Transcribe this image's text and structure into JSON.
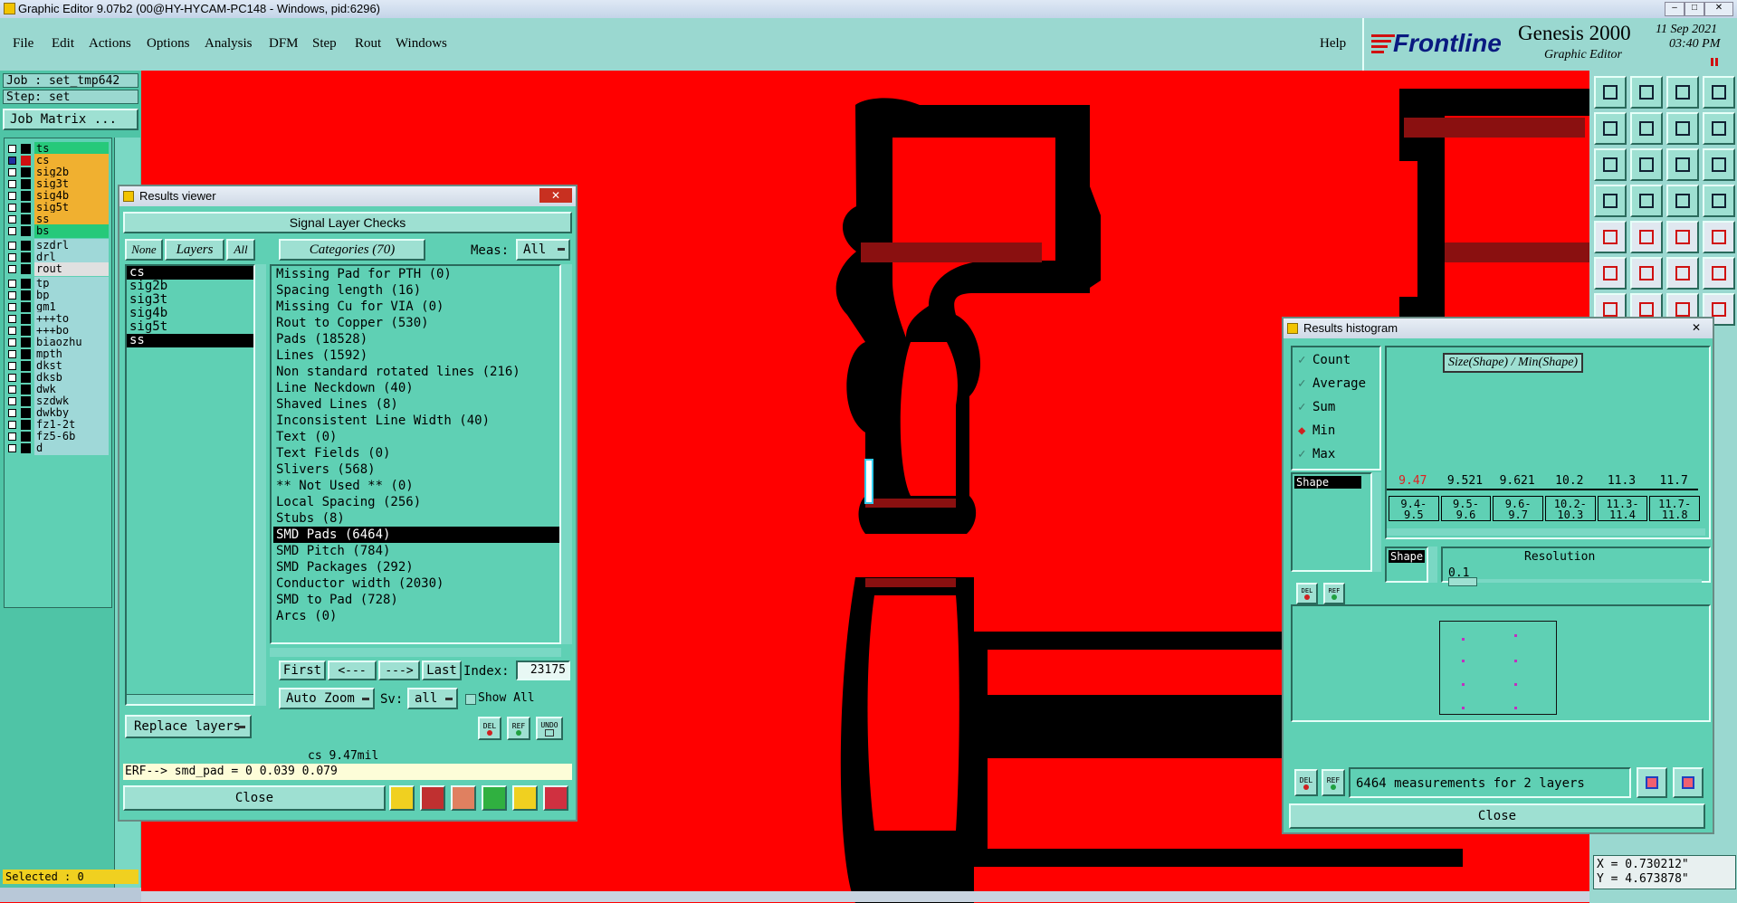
{
  "titlebar": {
    "title": "Graphic Editor 9.07b2 (00@HY-HYCAM-PC148 - Windows, pid:6296)"
  },
  "menu": [
    "File",
    "Edit",
    "Actions",
    "Options",
    "Analysis",
    "DFM",
    "Step",
    "Rout",
    "Windows"
  ],
  "help": "Help",
  "brand": {
    "logo": "Frontline",
    "product": "Genesis 2000",
    "subtitle": "Graphic Editor",
    "date": "11 Sep 2021",
    "time": "03:40 PM"
  },
  "job": {
    "job": "Job : set_tmp642",
    "step": "Step: set",
    "matrix_button": "Job Matrix ..."
  },
  "layers": [
    {
      "name": "ts",
      "color": "#26c97a"
    },
    {
      "name": "cs",
      "color": "#f0b030"
    },
    {
      "name": "sig2b",
      "color": "#f0b030"
    },
    {
      "name": "sig3t",
      "color": "#f0b030"
    },
    {
      "name": "sig4b",
      "color": "#f0b030"
    },
    {
      "name": "sig5t",
      "color": "#f0b030"
    },
    {
      "name": "ss",
      "color": "#f0b030"
    },
    {
      "name": "bs",
      "color": "#26c97a"
    },
    {
      "name": "szdrl",
      "color": "#9fd8d8"
    },
    {
      "name": "drl",
      "color": "#9fd8d8"
    },
    {
      "name": "rout",
      "color": "#e0e0e0"
    },
    {
      "name": "tp",
      "color": "#9fd8d8"
    },
    {
      "name": "bp",
      "color": "#9fd8d8"
    },
    {
      "name": "gm1",
      "color": "#9fd8d8"
    },
    {
      "name": "+++to",
      "color": "#9fd8d8"
    },
    {
      "name": "+++bo",
      "color": "#9fd8d8"
    },
    {
      "name": "biaozhu",
      "color": "#9fd8d8"
    },
    {
      "name": "mpth",
      "color": "#9fd8d8"
    },
    {
      "name": "dkst",
      "color": "#9fd8d8"
    },
    {
      "name": "dksb",
      "color": "#9fd8d8"
    },
    {
      "name": "dwk",
      "color": "#9fd8d8"
    },
    {
      "name": "szdwk",
      "color": "#9fd8d8"
    },
    {
      "name": "dwkby",
      "color": "#9fd8d8"
    },
    {
      "name": "fz1-2t",
      "color": "#9fd8d8"
    },
    {
      "name": "fz5-6b",
      "color": "#9fd8d8"
    },
    {
      "name": "d",
      "color": "#9fd8d8"
    }
  ],
  "selected": "Selected : 0",
  "coords": {
    "x": "X = 0.730212\"",
    "y": "Y = 4.673878\""
  },
  "results_viewer": {
    "title": "Results viewer",
    "header": "Signal Layer Checks",
    "none": "None",
    "layers": "Layers",
    "all": "All",
    "categories": "Categories (70)",
    "meas_label": "Meas:",
    "meas_value": "All",
    "layer_list": [
      "cs",
      "sig2b",
      "sig3t",
      "sig4b",
      "sig5t",
      "ss"
    ],
    "category_list": [
      "Missing Pad for PTH (0)",
      "Spacing length (16)",
      "Missing Cu for VIA (0)",
      "Rout to Copper (530)",
      "Pads (18528)",
      "Lines (1592)",
      "Non standard rotated lines (216)",
      "Line Neckdown (40)",
      "Shaved Lines (8)",
      "Inconsistent Line Width (40)",
      "Text (0)",
      "Text Fields (0)",
      "Slivers (568)",
      "** Not Used ** (0)",
      "Local Spacing (256)",
      "Stubs (8)",
      "SMD Pads (6464)",
      "SMD Pitch (784)",
      "SMD Packages (292)",
      "Conductor width (2030)",
      "SMD to Pad (728)",
      "Arcs (0)"
    ],
    "first": "First",
    "prev": "<---",
    "next": "--->",
    "last": "Last",
    "index_label": "Index:",
    "index_value": "23175",
    "auto_zoom": "Auto Zoom",
    "sv_label": "Sv:",
    "sv_value": "all",
    "show_all": "Show All",
    "replace_layers": "Replace layers",
    "del": "DEL",
    "ref": "REF",
    "undo": "UNDO",
    "status": "cs 9.47mil",
    "erf": "ERF--> smd_pad = 0 0.039 0.079",
    "close": "Close"
  },
  "histogram": {
    "title": "Results histogram",
    "options": [
      {
        "label": "Count",
        "checked": false
      },
      {
        "label": "Average",
        "checked": false
      },
      {
        "label": "Sum",
        "checked": false
      },
      {
        "label": "Min",
        "checked": true
      },
      {
        "label": "Max",
        "checked": false
      }
    ],
    "shape": "Shape",
    "size_label": "Size(Shape) / Min(Shape)",
    "top_values": [
      "9.47",
      "9.521",
      "9.621",
      "10.2",
      "11.3",
      "11.7"
    ],
    "ranges": [
      [
        "9.4-",
        "9.5"
      ],
      [
        "9.5-",
        "9.6"
      ],
      [
        "9.6-",
        "9.7"
      ],
      [
        "10.2-",
        "10.3"
      ],
      [
        "11.3-",
        "11.4"
      ],
      [
        "11.7-",
        "11.8"
      ]
    ],
    "resolution_label": "Resolution",
    "resolution_value": "0.1",
    "measurements": "6464 measurements for 2 layers",
    "del": "DEL",
    "ref": "REF",
    "close": "Close"
  }
}
